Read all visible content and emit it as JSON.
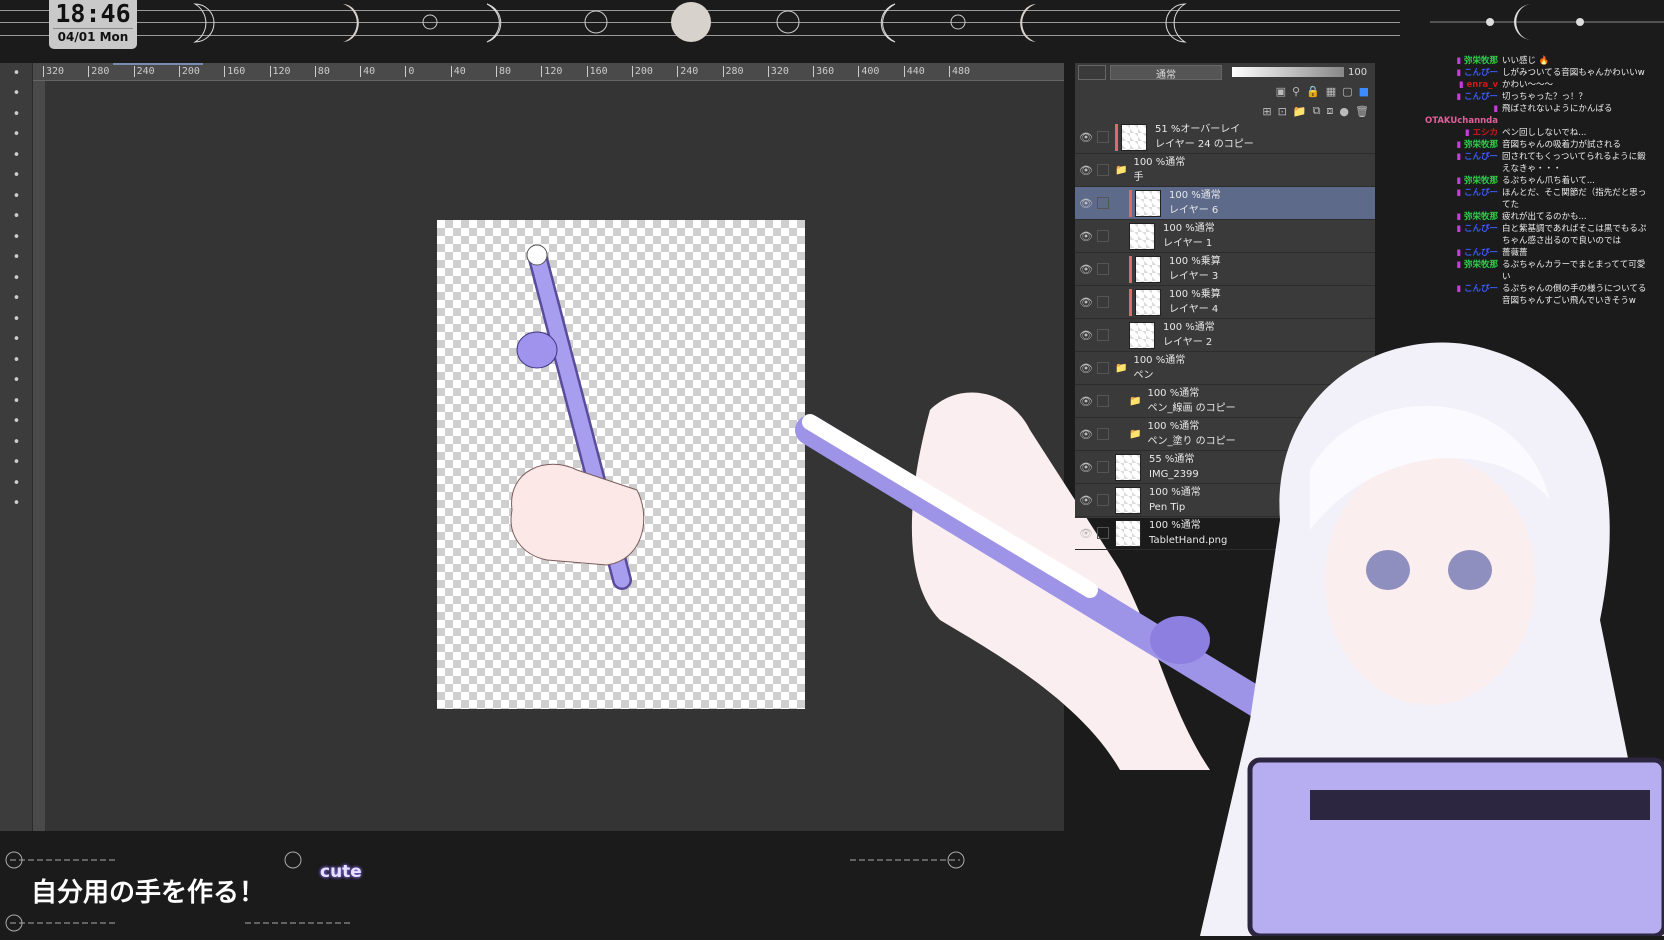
{
  "overlay": {
    "time": "18:46",
    "date": "04/01 Mon",
    "caption": "自分用の手を作る！",
    "sticker": "cute"
  },
  "ruler": {
    "labels": [
      "320",
      "280",
      "240",
      "200",
      "160",
      "120",
      "80",
      "40",
      "0",
      "40",
      "80",
      "120",
      "160",
      "200",
      "240",
      "280",
      "320",
      "360",
      "400",
      "440",
      "480"
    ]
  },
  "tools": [
    "search-icon",
    "hand-icon",
    "rotate-icon",
    "move-icon",
    "lasso-icon",
    "magic-wand-icon",
    "eyedropper-icon",
    "pen-icon",
    "brush-icon",
    "pencil-icon",
    "airbrush-icon",
    "decorate-icon",
    "eraser-icon",
    "blend-icon",
    "fill-icon",
    "gradient-icon",
    "figure-icon",
    "frame-icon",
    "ruler-icon",
    "text-icon",
    "balloon-icon",
    "line-correct-icon"
  ],
  "layer_panel": {
    "blend_mode": "通常",
    "opacity": "100",
    "layers": [
      {
        "mode": "51 %オーバーレイ",
        "name": "レイヤー 24 のコピー",
        "marked": true,
        "indent": 0,
        "selected": false
      },
      {
        "mode": "100 %通常",
        "name": "手",
        "marked": false,
        "indent": 0,
        "selected": false,
        "folder": true
      },
      {
        "mode": "100 %通常",
        "name": "レイヤー 6",
        "marked": true,
        "indent": 1,
        "selected": true
      },
      {
        "mode": "100 %通常",
        "name": "レイヤー 1",
        "marked": false,
        "indent": 1,
        "selected": false
      },
      {
        "mode": "100 %乗算",
        "name": "レイヤー 3",
        "marked": true,
        "indent": 1,
        "selected": false
      },
      {
        "mode": "100 %乗算",
        "name": "レイヤー 4",
        "marked": true,
        "indent": 1,
        "selected": false
      },
      {
        "mode": "100 %通常",
        "name": "レイヤー 2",
        "marked": false,
        "indent": 1,
        "selected": false
      },
      {
        "mode": "100 %通常",
        "name": "ペン",
        "marked": false,
        "indent": 0,
        "selected": false,
        "folder": true
      },
      {
        "mode": "100 %通常",
        "name": "ペン_線画 のコピー",
        "marked": false,
        "indent": 1,
        "selected": false,
        "folder": true
      },
      {
        "mode": "100 %通常",
        "name": "ペン_塗り のコピー",
        "marked": false,
        "indent": 1,
        "selected": false,
        "folder": true
      },
      {
        "mode": "55 %通常",
        "name": "IMG_2399",
        "marked": false,
        "indent": 0,
        "selected": false
      },
      {
        "mode": "100 %通常",
        "name": "Pen Tip",
        "marked": false,
        "indent": 0,
        "selected": false
      },
      {
        "mode": "100 %通常",
        "name": "TabletHand.png",
        "marked": false,
        "indent": 0,
        "selected": false
      }
    ]
  },
  "chat": [
    {
      "user": "弥栄牧那",
      "color": "#2fd04a",
      "text": "いい感じ 🔥"
    },
    {
      "user": "こんぴー",
      "color": "#3a5cff",
      "text": "しがみついてる音図もゃんかわいいw"
    },
    {
      "user": "enra_v",
      "color": "#d01818",
      "text": "かわい～～～"
    },
    {
      "user": "こんぴー",
      "color": "#3a5cff",
      "text": "切っちゃった？っ！？"
    },
    {
      "user": "OTAKUchannda",
      "color": "#e0609a",
      "text": "飛ばされないようにかんばる"
    },
    {
      "user": "エシカ",
      "color": "#d01818",
      "text": "ペン回ししないでね..."
    },
    {
      "user": "弥栄牧那",
      "color": "#2fd04a",
      "text": "音図ちゃんの吸着力が試される"
    },
    {
      "user": "こんぴー",
      "color": "#3a5cff",
      "text": "回されてもくっついてられるように鍛えなきゃ・・・"
    },
    {
      "user": "弥栄牧那",
      "color": "#2fd04a",
      "text": "るぷちゃん爪ち着いて..."
    },
    {
      "user": "こんぴー",
      "color": "#3a5cff",
      "text": "ほんとだ、そこ関節だ（指先だと思ってた"
    },
    {
      "user": "弥栄牧那",
      "color": "#2fd04a",
      "text": "疲れが出てるのかも..."
    },
    {
      "user": "こんぴー",
      "color": "#3a5cff",
      "text": "白と紫基調であればそこは黒でもるぷちゃん感さ出るので良いのでは"
    },
    {
      "user": "こんぴー",
      "color": "#3a5cff",
      "text": "薔薇薔"
    },
    {
      "user": "弥栄牧那",
      "color": "#2fd04a",
      "text": "るぷちゃんカラーでまとまってて可愛い"
    },
    {
      "user": "こんぴー",
      "color": "#3a5cff",
      "text": "るぷちゃんの側の手の様うについてる音図ちゃんすごい飛んでいきそうw"
    }
  ]
}
